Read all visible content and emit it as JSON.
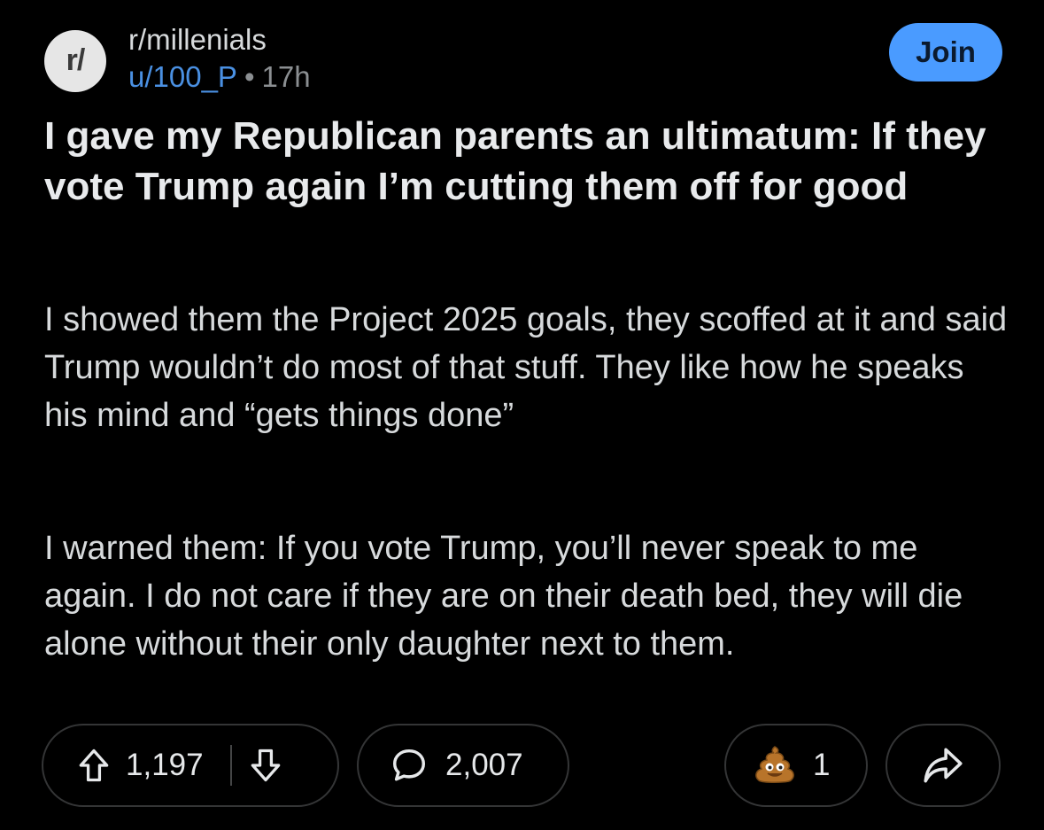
{
  "post": {
    "subreddit_avatar_text": "r/",
    "subreddit": "r/millenials",
    "author": "u/100_P",
    "separator": "•",
    "age": "17h",
    "join_label": "Join",
    "title": "I gave my Republican parents an ultimatum: If they vote Trump again I’m cutting them off for good",
    "body": [
      "I showed them the Project 2025 goals, they scoffed at it and said Trump wouldn’t do most of that stuff. They like how he speaks his mind and “gets things done”",
      "I warned them: If you vote Trump, you’ll never speak to me again. I do not care if they are on their death bed, they will die alone without their only daughter next to them."
    ]
  },
  "actions": {
    "upvotes": "1,197",
    "comments": "2,007",
    "awards": "1",
    "upvote_icon": "arrow-up-icon",
    "downvote_icon": "arrow-down-icon",
    "comment_icon": "comment-bubble-icon",
    "award_icon": "poop-award-icon",
    "share_icon": "share-arrow-icon"
  },
  "colors": {
    "background": "#000000",
    "join_button": "#4a9bff",
    "author_link": "#4a90e2",
    "pill_border": "#343536"
  }
}
